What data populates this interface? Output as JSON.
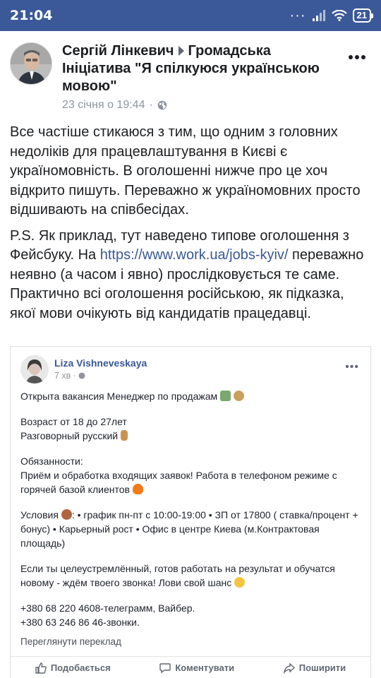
{
  "status_bar": {
    "time": "21:04",
    "battery": "21"
  },
  "post": {
    "author": "Сергій Лінкевич",
    "group": "Громадська Ініціатива \"Я спілкуюся українською мовою\"",
    "date": "23 січня о 19:44",
    "separator": "·",
    "paragraph1": "Все частіше стикаюся з тим, що одним з головних недоліків для працевлаштування в Києві є україномовність. В оголошенні нижче про це хоч відкрито пишуть. Переважно ж україномовних просто відшивають на співбесідах.",
    "paragraph2_before": "P.S. Як приклад, тут наведено типове оголошення з Фейсбуку. На ",
    "link": "https://www.work.ua/jobs-kyiv/",
    "paragraph2_after": " переважно неявно (а часом і явно) прослідковується те саме. Практично всі оголошення російською, як підказка, якої мови очікують від кандидатів працедавці."
  },
  "embedded": {
    "name": "Liza Vishneveskaya",
    "time": "7 хв",
    "line1": "Открыта вакансия Менеджер по продажам",
    "line2": "Возраст от 18 до 27лет",
    "line3": "Разговорный русский",
    "line4": "Обязанности:",
    "line5": "Приём и обработка входящих заявок! Работа в телефоном режиме с горячей базой клиентов",
    "line6a": "Условия",
    "line6b": ": • график пн-пт с 10:00-19:00 • ЗП от 17800 ( ставка/процент + бонус) • Карьерный рост • Офис в центре Киева (м.Контрактовая площадь)",
    "line7": "Если ты целеустремлённый, готов работать на результат и обучатся новому - ждём твоего звонка! Лови свой шанс",
    "line8": "+380 68 220 4608-телеграмм, Вайбер.",
    "line9": "+380 63 246 86 46-звонки.",
    "translate": "Переглянути переклад",
    "actions": {
      "like": "Подобається",
      "comment": "Коментувати",
      "share": "Поширити"
    }
  },
  "colors": {
    "status_bar": "#3b5998",
    "link": "#385898",
    "embed_name": "#365899"
  }
}
